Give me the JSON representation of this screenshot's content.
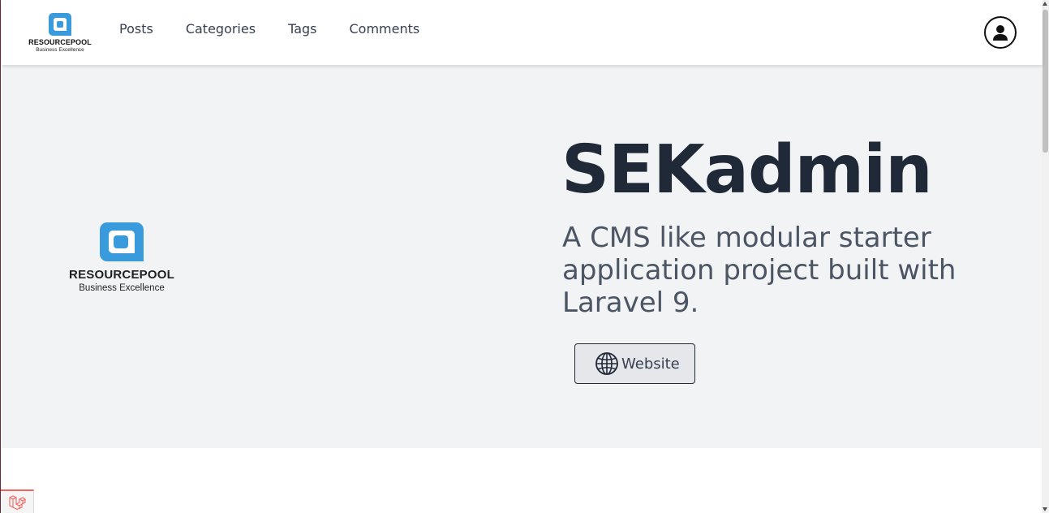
{
  "header": {
    "logo": {
      "brand": "RESOURCEPOOL",
      "tagline": "Business Excellence"
    },
    "nav": [
      {
        "label": "Posts"
      },
      {
        "label": "Categories"
      },
      {
        "label": "Tags"
      },
      {
        "label": "Comments"
      }
    ],
    "user_icon": "user-circle-icon"
  },
  "hero": {
    "logo": {
      "brand": "RESOURCEPOOL",
      "tagline": "Business Excellence"
    },
    "title": "SEKadmin",
    "subtitle": "A CMS like modular starter application project built with Laravel 9.",
    "website_button": {
      "label": "Website",
      "icon": "globe-icon"
    }
  },
  "debugbar": {
    "icon": "laravel-icon"
  },
  "colors": {
    "brand_blue": "#3a9bdc",
    "hero_bg": "#f2f3f5",
    "title": "#1f2937",
    "subtitle": "#4b5563",
    "laravel_red": "#f4645f"
  }
}
